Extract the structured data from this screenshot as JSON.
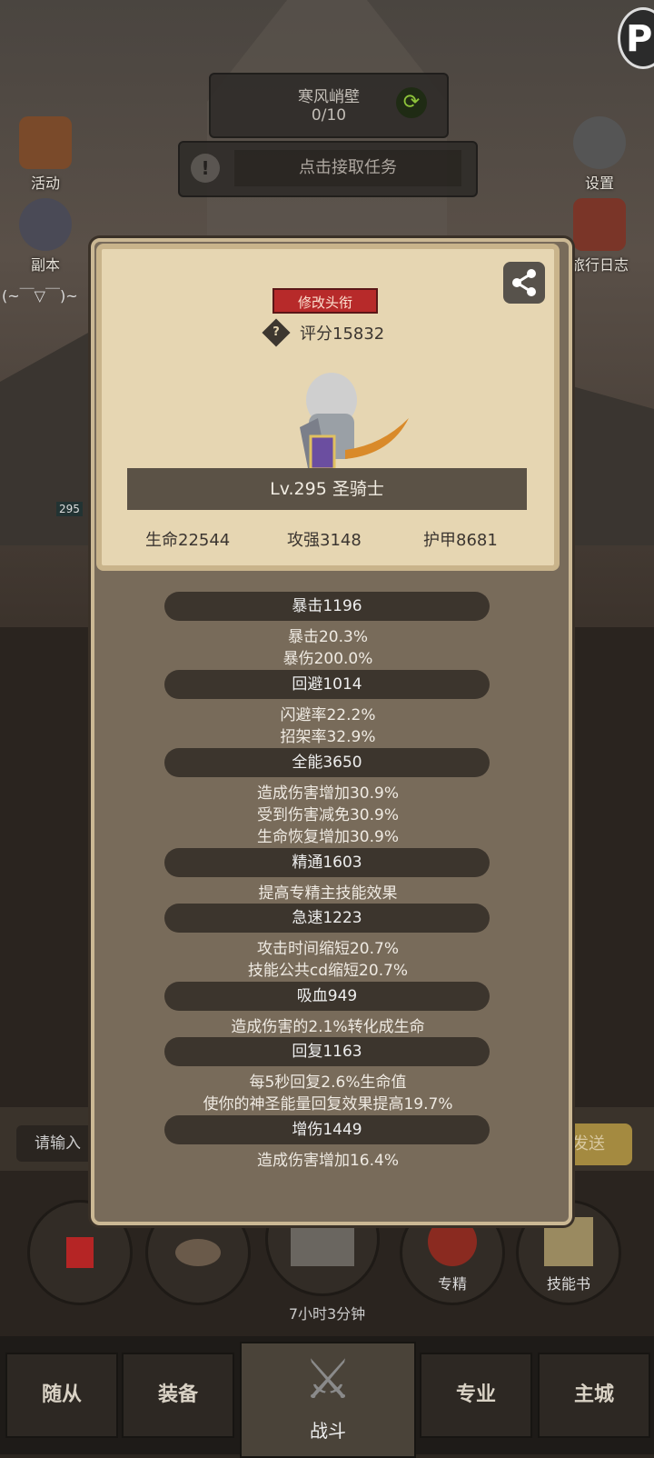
{
  "quest": {
    "title": "寒风峭壁",
    "progress": "0/10",
    "task_label": "点击接取任务"
  },
  "left_icons": [
    {
      "label": "活动"
    },
    {
      "label": "副本"
    }
  ],
  "right_icons": [
    {
      "label": "设置"
    },
    {
      "label": "旅行日志"
    }
  ],
  "kaomoji": "(~￣▽￣)~",
  "corner_badge": "295",
  "card": {
    "title_button": "修改头衔",
    "score": "评分15832",
    "level": "Lv.295 圣骑士",
    "hp": "生命22544",
    "atk": "攻强3148",
    "armor": "护甲8681"
  },
  "stats": [
    {
      "header": "暴击1196",
      "lines": [
        "暴击20.3%",
        "暴伤200.0%"
      ]
    },
    {
      "header": "回避1014",
      "lines": [
        "闪避率22.2%",
        "招架率32.9%"
      ]
    },
    {
      "header": "全能3650",
      "lines": [
        "造成伤害增加30.9%",
        "受到伤害减免30.9%",
        "生命恢复增加30.9%"
      ]
    },
    {
      "header": "精通1603",
      "lines": [
        "提高专精主技能效果"
      ]
    },
    {
      "header": "急速1223",
      "lines": [
        "攻击时间缩短20.7%",
        "技能公共cd缩短20.7%"
      ]
    },
    {
      "header": "吸血949",
      "lines": [
        "造成伤害的2.1%转化成生命"
      ]
    },
    {
      "header": "回复1163",
      "lines": [
        "每5秒回复2.6%生命值",
        "使你的神圣能量回复效果提高19.7%"
      ]
    },
    {
      "header": "增伤1449",
      "lines": [
        "造成伤害增加16.4%"
      ]
    }
  ],
  "chat": {
    "placeholder": "请输入",
    "send": "发送"
  },
  "bottom_buttons": [
    {
      "label": ""
    },
    {
      "label": ""
    },
    {
      "label": ""
    },
    {
      "label": "专精"
    },
    {
      "label": "技能书"
    }
  ],
  "timer": "7小时3分钟",
  "tabs": {
    "follower": "随从",
    "equip": "装备",
    "battle": "战斗",
    "profession": "专业",
    "city": "主城"
  }
}
